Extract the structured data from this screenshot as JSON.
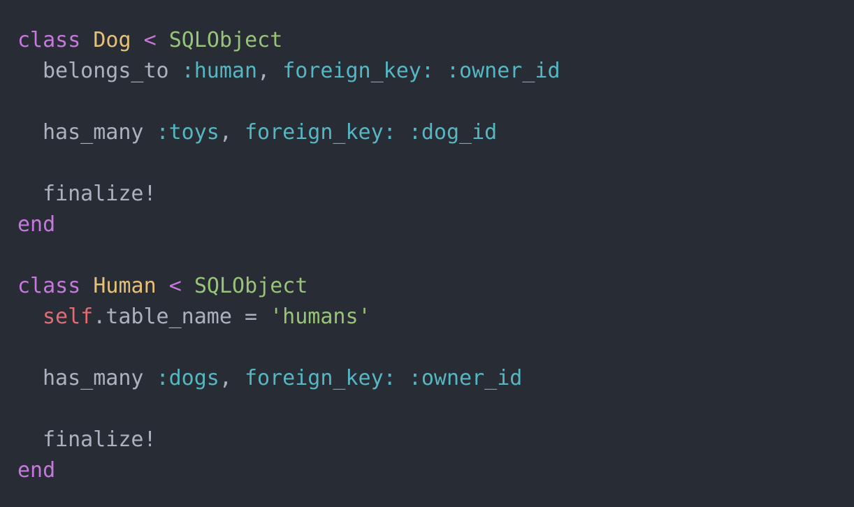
{
  "editor": {
    "background": "#282c34",
    "colors": {
      "keyword": "#c678dd",
      "class_name": "#e5c07b",
      "superclass": "#98c379",
      "plain": "#abb2bf",
      "symbol": "#56b6c2",
      "self": "#e06c75",
      "string": "#98c379"
    },
    "lines": [
      {
        "indent": 0,
        "tokens": [
          {
            "type": "keyword",
            "text": "class"
          },
          {
            "type": "plain",
            "text": " "
          },
          {
            "type": "class",
            "text": "Dog"
          },
          {
            "type": "plain",
            "text": " "
          },
          {
            "type": "keyword",
            "text": "<"
          },
          {
            "type": "plain",
            "text": " "
          },
          {
            "type": "super",
            "text": "SQLObject"
          }
        ]
      },
      {
        "indent": 1,
        "tokens": [
          {
            "type": "plain",
            "text": "belongs_to"
          },
          {
            "type": "plain",
            "text": " "
          },
          {
            "type": "symbol",
            "text": ":human"
          },
          {
            "type": "plain",
            "text": ", "
          },
          {
            "type": "symbol",
            "text": "foreign_key:"
          },
          {
            "type": "plain",
            "text": " "
          },
          {
            "type": "symbol",
            "text": ":owner_id"
          }
        ]
      },
      {
        "indent": 0,
        "tokens": []
      },
      {
        "indent": 1,
        "tokens": [
          {
            "type": "plain",
            "text": "has_many"
          },
          {
            "type": "plain",
            "text": " "
          },
          {
            "type": "symbol",
            "text": ":toys"
          },
          {
            "type": "plain",
            "text": ", "
          },
          {
            "type": "symbol",
            "text": "foreign_key:"
          },
          {
            "type": "plain",
            "text": " "
          },
          {
            "type": "symbol",
            "text": ":dog_id"
          }
        ]
      },
      {
        "indent": 0,
        "tokens": []
      },
      {
        "indent": 1,
        "tokens": [
          {
            "type": "plain",
            "text": "finalize!"
          }
        ]
      },
      {
        "indent": 0,
        "tokens": [
          {
            "type": "keyword",
            "text": "end"
          }
        ]
      },
      {
        "indent": 0,
        "tokens": []
      },
      {
        "indent": 0,
        "tokens": [
          {
            "type": "keyword",
            "text": "class"
          },
          {
            "type": "plain",
            "text": " "
          },
          {
            "type": "class",
            "text": "Human"
          },
          {
            "type": "plain",
            "text": " "
          },
          {
            "type": "keyword",
            "text": "<"
          },
          {
            "type": "plain",
            "text": " "
          },
          {
            "type": "super",
            "text": "SQLObject"
          }
        ]
      },
      {
        "indent": 1,
        "tokens": [
          {
            "type": "self",
            "text": "self"
          },
          {
            "type": "plain",
            "text": ".table_name = "
          },
          {
            "type": "string",
            "text": "'humans'"
          }
        ]
      },
      {
        "indent": 0,
        "tokens": []
      },
      {
        "indent": 1,
        "tokens": [
          {
            "type": "plain",
            "text": "has_many"
          },
          {
            "type": "plain",
            "text": " "
          },
          {
            "type": "symbol",
            "text": ":dogs"
          },
          {
            "type": "plain",
            "text": ", "
          },
          {
            "type": "symbol",
            "text": "foreign_key:"
          },
          {
            "type": "plain",
            "text": " "
          },
          {
            "type": "symbol",
            "text": ":owner_id"
          }
        ]
      },
      {
        "indent": 0,
        "tokens": []
      },
      {
        "indent": 1,
        "tokens": [
          {
            "type": "plain",
            "text": "finalize!"
          }
        ]
      },
      {
        "indent": 0,
        "tokens": [
          {
            "type": "keyword",
            "text": "end"
          }
        ]
      }
    ]
  }
}
